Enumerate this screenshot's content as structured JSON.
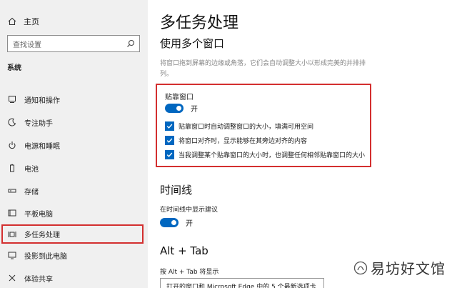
{
  "sidebar": {
    "home_label": "主页",
    "search_placeholder": "查找设置",
    "section_label": "系统",
    "items": [
      {
        "label": "通知和操作",
        "icon": "notification-icon"
      },
      {
        "label": "专注助手",
        "icon": "moon-icon"
      },
      {
        "label": "电源和睡眠",
        "icon": "power-icon"
      },
      {
        "label": "电池",
        "icon": "battery-icon"
      },
      {
        "label": "存储",
        "icon": "storage-icon"
      },
      {
        "label": "平板电脑",
        "icon": "tablet-icon"
      },
      {
        "label": "多任务处理",
        "icon": "multitasking-icon",
        "selected": true
      },
      {
        "label": "投影到此电脑",
        "icon": "project-icon"
      },
      {
        "label": "体验共享",
        "icon": "share-icon"
      }
    ]
  },
  "main": {
    "title": "多任务处理",
    "snap_section": {
      "title": "使用多个窗口",
      "description": "将窗口拖到屏幕的边缘或角落，它们会自动调整大小以形成完美的并排排列。",
      "snap_label": "贴靠窗口",
      "toggle_state": "开",
      "options": [
        {
          "label": "贴靠窗口时自动调整窗口的大小，填满可用空间",
          "checked": true
        },
        {
          "label": "将窗口对齐时，显示能够在其旁边对齐的内容",
          "checked": true
        },
        {
          "label": "当我调整某个贴靠窗口的大小时，也调整任何相邻贴靠窗口的大小",
          "checked": true
        }
      ]
    },
    "timeline_section": {
      "title": "时间线",
      "label": "在时间线中显示建议",
      "toggle_state": "开"
    },
    "alttab_section": {
      "title": "Alt + Tab",
      "label": "按 Alt + Tab 将显示",
      "dropdown_value": "打开的窗口和 Microsoft Edge 中的 5 个最新选项卡"
    }
  },
  "watermark": {
    "text": "易坊好文馆"
  },
  "colors": {
    "accent": "#0067c0",
    "highlight_border": "#d32f2f",
    "sidebar_bg": "#f0f0f0"
  }
}
